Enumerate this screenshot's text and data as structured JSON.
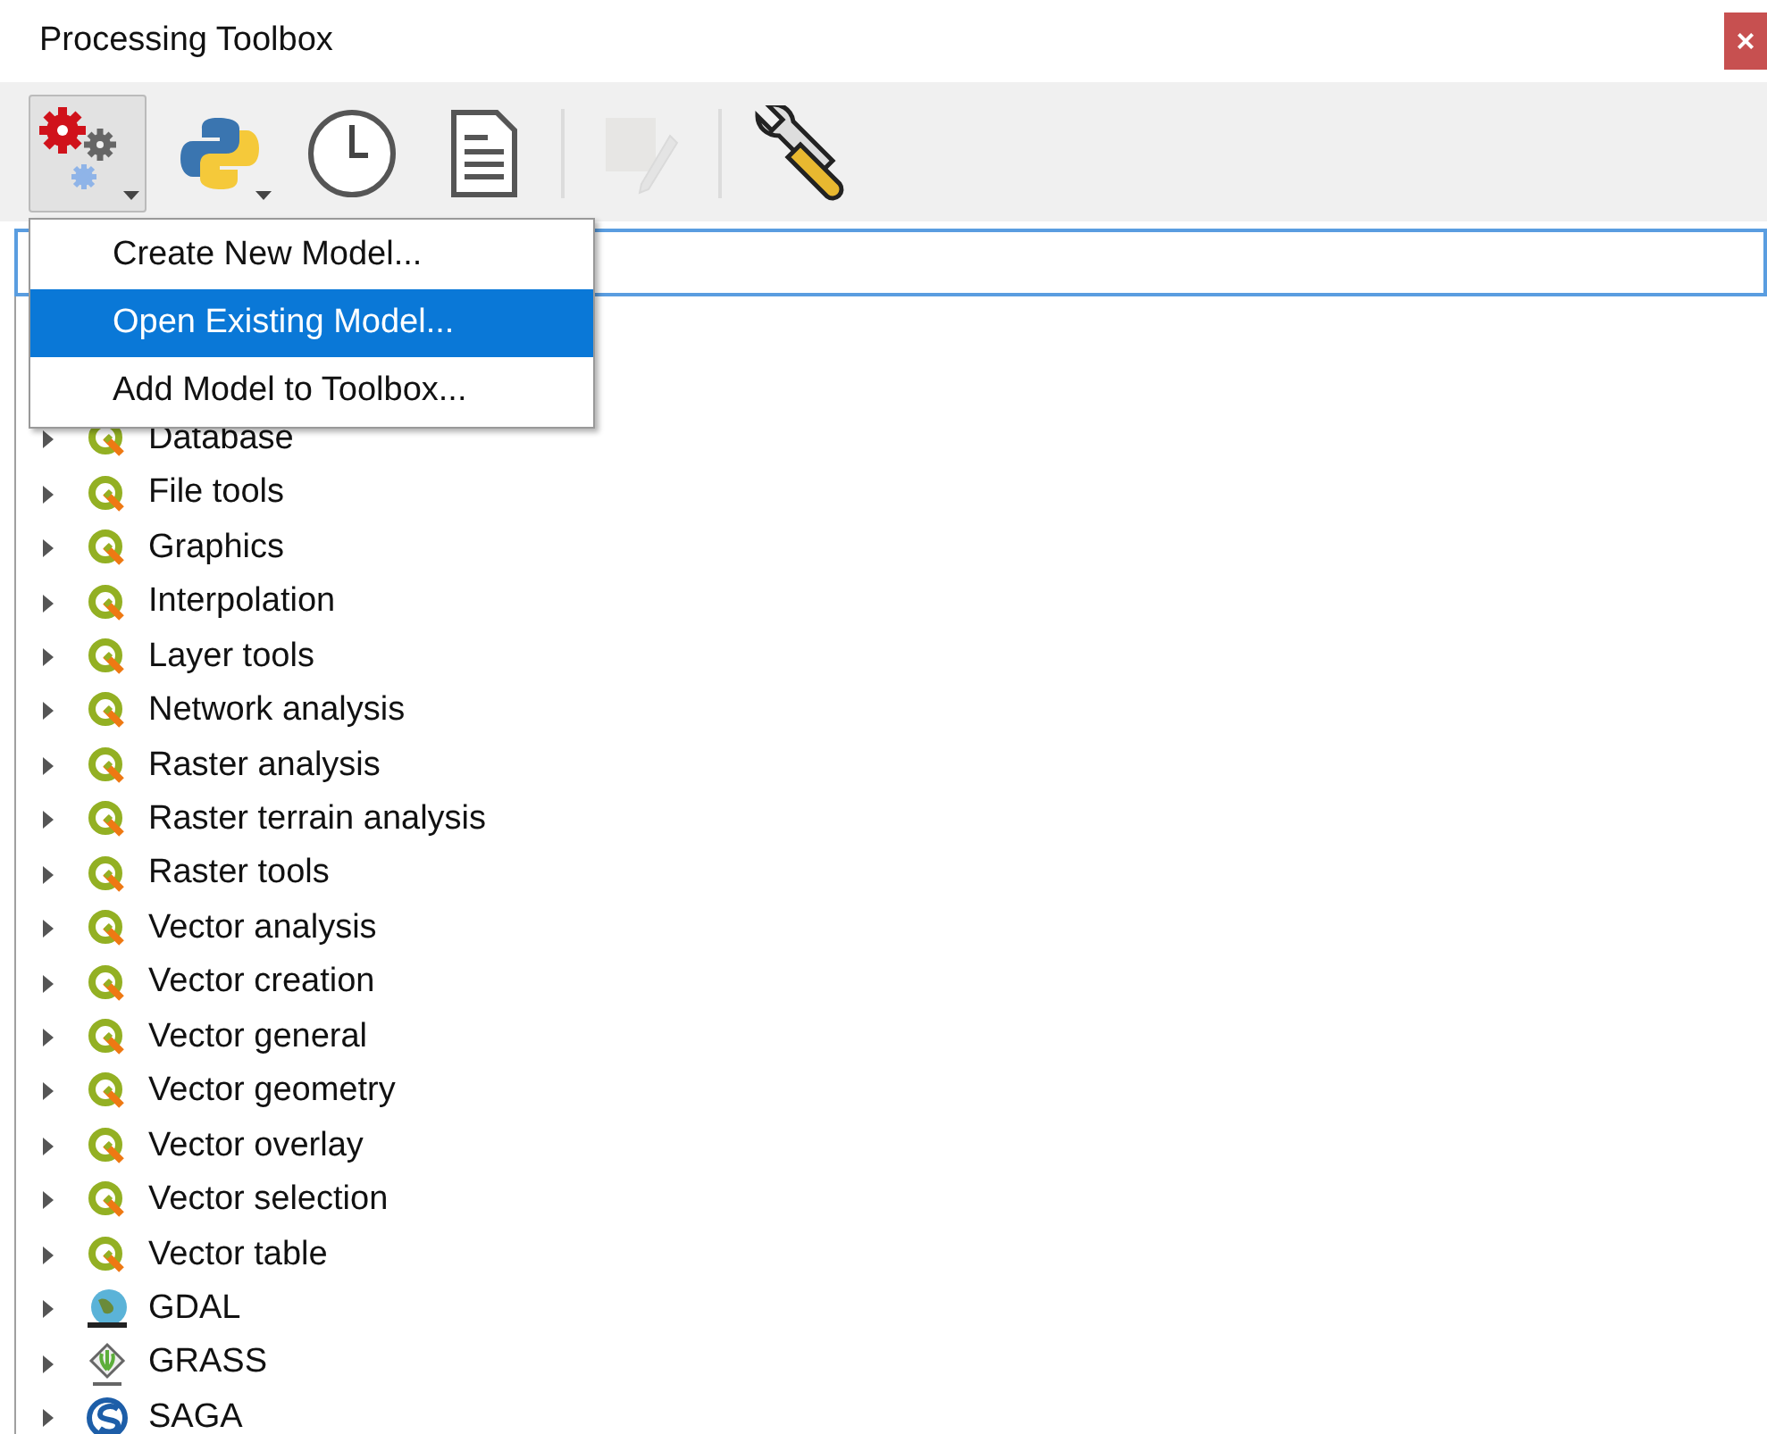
{
  "window": {
    "title": "Processing Toolbox",
    "close": "×"
  },
  "toolbar": {
    "buttons": [
      {
        "kind": "models",
        "pressed": true,
        "dropdown": true,
        "disabled": false
      },
      {
        "kind": "python",
        "pressed": false,
        "dropdown": true,
        "disabled": false
      },
      {
        "kind": "history",
        "pressed": false,
        "dropdown": false,
        "disabled": false
      },
      {
        "kind": "results",
        "pressed": false,
        "dropdown": false,
        "disabled": false
      },
      {
        "kind": "separator"
      },
      {
        "kind": "edit",
        "pressed": false,
        "dropdown": false,
        "disabled": true
      },
      {
        "kind": "separator"
      },
      {
        "kind": "options",
        "pressed": false,
        "dropdown": false,
        "disabled": false
      }
    ]
  },
  "menu": {
    "items": [
      {
        "label": "Create New Model...",
        "selected": false
      },
      {
        "label": "Open Existing Model...",
        "selected": true
      },
      {
        "label": "Add Model to Toolbox...",
        "selected": false
      }
    ]
  },
  "tree": {
    "items": [
      {
        "label": "Database",
        "kind": "qgis",
        "expanded": false
      },
      {
        "label": "File tools",
        "kind": "qgis",
        "expanded": false
      },
      {
        "label": "Graphics",
        "kind": "qgis",
        "expanded": false
      },
      {
        "label": "Interpolation",
        "kind": "qgis",
        "expanded": false
      },
      {
        "label": "Layer tools",
        "kind": "qgis",
        "expanded": false
      },
      {
        "label": "Network analysis",
        "kind": "qgis",
        "expanded": false
      },
      {
        "label": "Raster analysis",
        "kind": "qgis",
        "expanded": false
      },
      {
        "label": "Raster terrain analysis",
        "kind": "qgis",
        "expanded": false
      },
      {
        "label": "Raster tools",
        "kind": "qgis",
        "expanded": false
      },
      {
        "label": "Vector analysis",
        "kind": "qgis",
        "expanded": false
      },
      {
        "label": "Vector creation",
        "kind": "qgis",
        "expanded": false
      },
      {
        "label": "Vector general",
        "kind": "qgis",
        "expanded": false
      },
      {
        "label": "Vector geometry",
        "kind": "qgis",
        "expanded": false
      },
      {
        "label": "Vector overlay",
        "kind": "qgis",
        "expanded": false
      },
      {
        "label": "Vector selection",
        "kind": "qgis",
        "expanded": false
      },
      {
        "label": "Vector table",
        "kind": "qgis",
        "expanded": false
      },
      {
        "label": "GDAL",
        "kind": "gdal",
        "expanded": false
      },
      {
        "label": "GRASS",
        "kind": "grass",
        "expanded": false
      },
      {
        "label": "SAGA",
        "kind": "saga",
        "expanded": false
      }
    ]
  }
}
